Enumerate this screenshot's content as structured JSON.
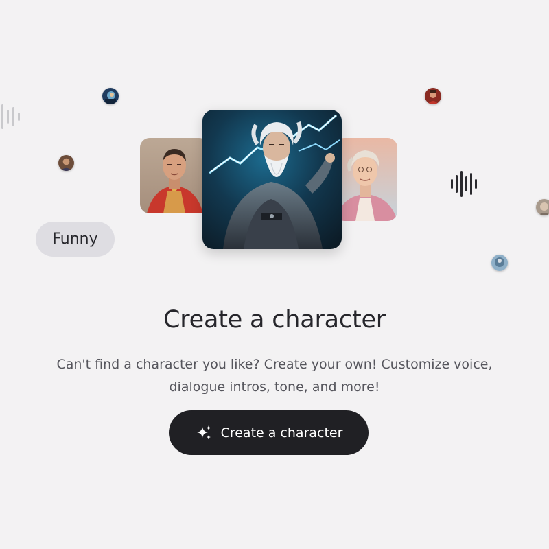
{
  "tag_pill": {
    "label": "Funny"
  },
  "cards": [
    {
      "name": "roman-general-portrait"
    },
    {
      "name": "wizard-lightning-portrait"
    },
    {
      "name": "elderly-aristocrat-portrait"
    }
  ],
  "empty_state": {
    "title": "Create a character",
    "description_line1": "Can't find a character you like? Create your own! Customize voice,",
    "description_line2": "dialogue intros, tone, and more!"
  },
  "cta": {
    "label": "Create a character",
    "icon": "sparkles-icon"
  },
  "colors": {
    "background": "#f3f2f3",
    "button": "#202024",
    "pill": "#dedde2",
    "text": "#26262b"
  }
}
